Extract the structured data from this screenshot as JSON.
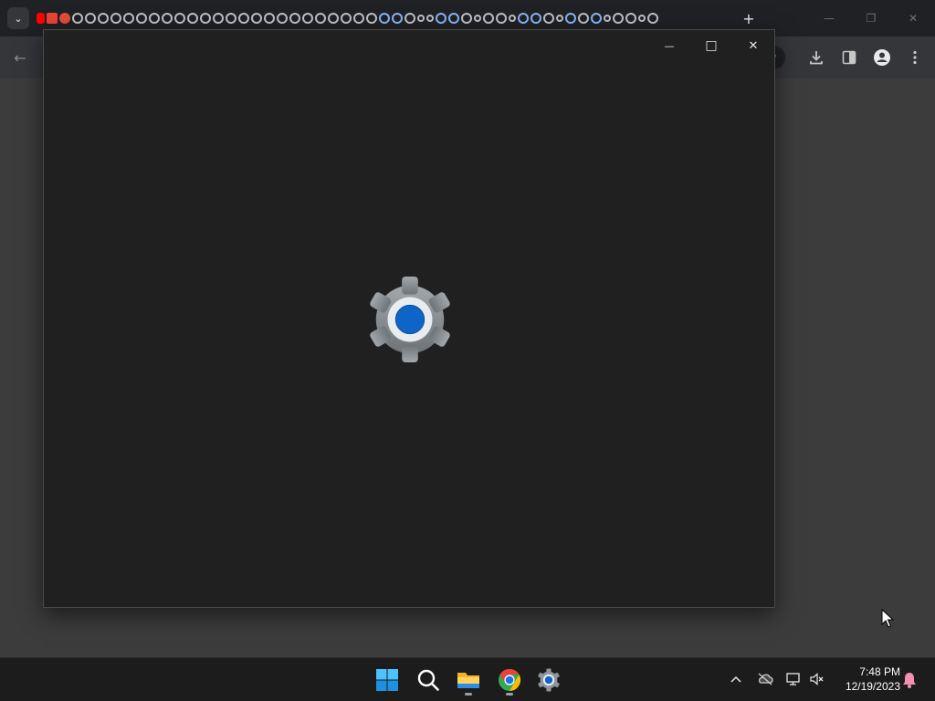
{
  "browser": {
    "new_tab_symbol": "+",
    "minimize_symbol": "—",
    "restore_symbol": "❐",
    "close_symbol": "✕",
    "back_symbol": "←",
    "tab_search_symbol": "⌄",
    "icons": [
      "download-icon",
      "side-panel-icon",
      "profile-icon",
      "menu-icon"
    ]
  },
  "settings_window": {
    "minimize_symbol": "—",
    "maximize_symbol": "□",
    "close_symbol": "✕",
    "splash_icon": "settings-gear-icon",
    "accent_color": "#0f64c8"
  },
  "taskbar": {
    "apps": [
      "start-icon",
      "search-icon",
      "file-explorer-icon",
      "chrome-icon",
      "settings-icon"
    ],
    "tray_overflow_symbol": "^",
    "time": "7:48 PM",
    "date": "12/19/2023"
  }
}
